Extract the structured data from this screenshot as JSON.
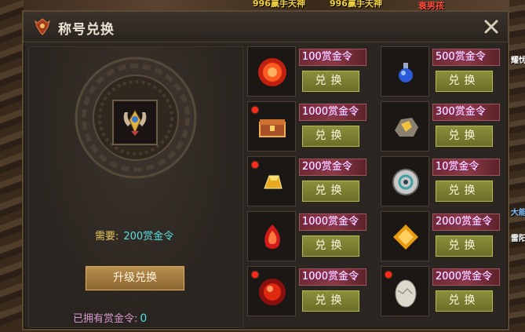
{
  "world": {
    "player_tags": [
      "996赢手天神",
      "996赢手天神"
    ],
    "player_name_right": "衰男孩",
    "side_text_1": "耀忧",
    "side_text_2": "大能",
    "side_text_3": "雷阳"
  },
  "dialog": {
    "title": "称号兑换",
    "close_icon": "close-icon"
  },
  "left": {
    "need_label": "需要:",
    "need_value": "200赏金令",
    "upgrade_button": "升级兑换",
    "owned_label": "已拥有赏金令:",
    "owned_value": "0"
  },
  "exchange_button_label": "兑换",
  "items": [
    {
      "price": "100赏金令",
      "icon": "red-orb-icon",
      "red_dot": false
    },
    {
      "price": "500赏金令",
      "icon": "blue-potion-icon",
      "red_dot": false
    },
    {
      "price": "1000赏金令",
      "icon": "treasure-chest-icon",
      "red_dot": true
    },
    {
      "price": "300赏金令",
      "icon": "gold-ore-icon",
      "red_dot": false
    },
    {
      "price": "200赏金令",
      "icon": "gold-bar-icon",
      "red_dot": true
    },
    {
      "price": "10赏金令",
      "icon": "rune-stone-icon",
      "red_dot": false
    },
    {
      "price": "1000赏金令",
      "icon": "red-gem-icon",
      "red_dot": false
    },
    {
      "price": "2000赏金令",
      "icon": "gold-crystal-icon",
      "red_dot": false
    },
    {
      "price": "1000赏金令",
      "icon": "fire-orb-icon",
      "red_dot": true
    },
    {
      "price": "2000赏金令",
      "icon": "dragon-egg-icon",
      "red_dot": true
    }
  ]
}
